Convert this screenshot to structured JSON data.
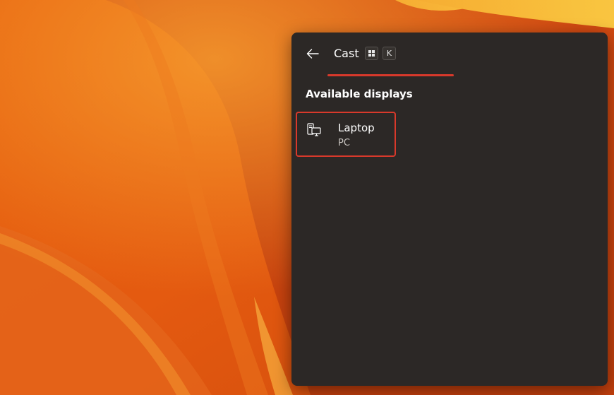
{
  "colors": {
    "panel_bg": "#2c2826",
    "accent_red": "#d8392b"
  },
  "cast_panel": {
    "title": "Cast",
    "shortcut_keys": [
      "win-key-icon",
      "K"
    ],
    "back_icon": "arrow-left-icon",
    "section_title": "Available displays",
    "displays": [
      {
        "icon": "computer-display-icon",
        "name": "Laptop",
        "type": "PC"
      }
    ]
  }
}
